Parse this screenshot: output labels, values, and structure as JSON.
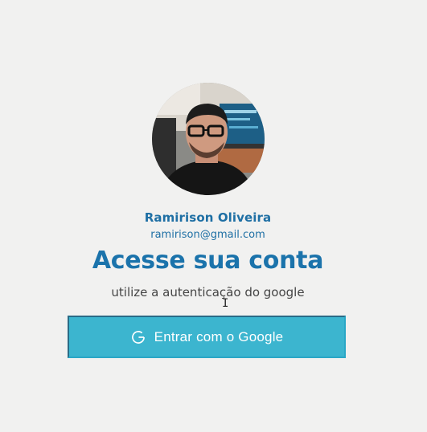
{
  "profile": {
    "name": "Ramirison Oliveira",
    "email": "ramirison@gmail.com"
  },
  "login": {
    "heading": "Acesse sua conta",
    "subtitle": "utilize a autenticação do google",
    "button_label": "Entrar com o Google",
    "button_icon": "google-g-icon"
  },
  "colors": {
    "accent": "#1b73ab",
    "button": "#3cb5cf",
    "background": "#f1f1f0"
  }
}
